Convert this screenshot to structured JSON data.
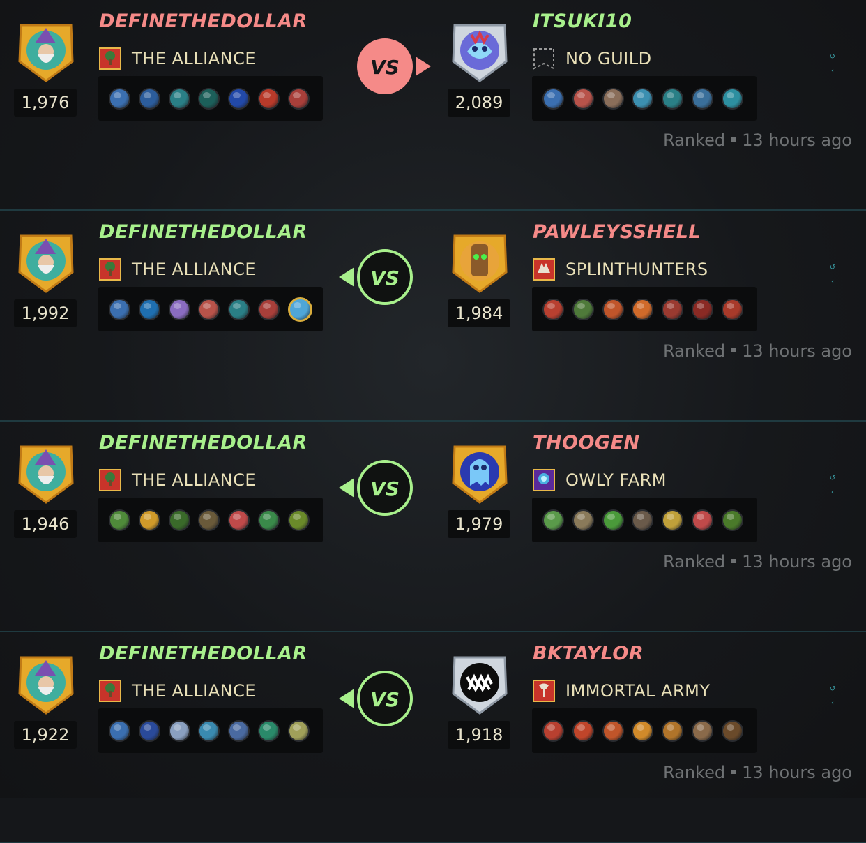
{
  "colors": {
    "winner": "#a8f08c",
    "loser": "#f58a88",
    "divider": "#1f3a40"
  },
  "battles": [
    {
      "vs_outcome": "right_won",
      "left": {
        "name": "DEFINETHEDOLLAR",
        "guild": "THE ALLIANCE",
        "guild_icon": "tree-banner-icon",
        "rating": "1,976",
        "avatar": "wizard-avatar",
        "result": "loser",
        "cards": [
          "#3b6fb0",
          "#2c5d9c",
          "#2a7f86",
          "#1c5f5a",
          "#2249a8",
          "#b83a2a",
          "#a83f3a"
        ]
      },
      "right": {
        "name": "ITSUKI10",
        "guild": "NO GUILD",
        "guild_icon": "no-guild-icon",
        "rating": "2,089",
        "avatar": "blue-monster-avatar",
        "result": "winner",
        "cards": [
          "#3b6fb0",
          "#b8534a",
          "#8a6e5a",
          "#3c8fb0",
          "#2a7f86",
          "#3a6f9a",
          "#2d8fa0"
        ]
      },
      "meta": {
        "type": "Ranked",
        "time": "13 hours ago"
      }
    },
    {
      "vs_outcome": "left_won",
      "left": {
        "name": "DEFINETHEDOLLAR",
        "guild": "THE ALLIANCE",
        "guild_icon": "tree-banner-icon",
        "rating": "1,992",
        "avatar": "wizard-avatar",
        "result": "winner",
        "cards": [
          "#3b6fb0",
          "#1f6fb0",
          "#8a6cc0",
          "#b8534a",
          "#2a7f86",
          "#a83f3a",
          "#4fa6d8"
        ]
      },
      "right": {
        "name": "PAWLEYSSHELL",
        "guild": "SPLINTHUNTERS",
        "guild_icon": "wolf-banner-icon",
        "rating": "1,984",
        "avatar": "tree-creature-avatar",
        "result": "loser",
        "cards": [
          "#b84030",
          "#4f7a3a",
          "#c0552a",
          "#d06a2a",
          "#9a3a30",
          "#8a2a24",
          "#a83a2a"
        ]
      },
      "meta": {
        "type": "Ranked",
        "time": "13 hours ago"
      }
    },
    {
      "vs_outcome": "left_won",
      "left": {
        "name": "DEFINETHEDOLLAR",
        "guild": "THE ALLIANCE",
        "guild_icon": "tree-banner-icon",
        "rating": "1,946",
        "avatar": "wizard-avatar",
        "result": "winner",
        "cards": [
          "#4f8a3a",
          "#d09a2a",
          "#3a6a2a",
          "#6a5a3a",
          "#c04a4a",
          "#3a8a4a",
          "#6a8a2a"
        ]
      },
      "right": {
        "name": "THOOGEN",
        "guild": "OWLY FARM",
        "guild_icon": "orb-banner-icon",
        "rating": "1,979",
        "avatar": "ghost-avatar",
        "result": "loser",
        "cards": [
          "#5a9a4a",
          "#8a7a5a",
          "#4a9a3a",
          "#6a5a4a",
          "#c0a03a",
          "#c04a4a",
          "#4a7a2a"
        ]
      },
      "meta": {
        "type": "Ranked",
        "time": "13 hours ago"
      }
    },
    {
      "vs_outcome": "left_won",
      "left": {
        "name": "DEFINETHEDOLLAR",
        "guild": "THE ALLIANCE",
        "guild_icon": "tree-banner-icon",
        "rating": "1,922",
        "avatar": "wizard-avatar",
        "result": "winner",
        "cards": [
          "#3b6fb0",
          "#2a4a9a",
          "#8aa0c0",
          "#3a8ab0",
          "#4a6aa0",
          "#2a8a6a",
          "#a0a05a"
        ]
      },
      "right": {
        "name": "BKTAYLOR",
        "guild": "IMMORTAL ARMY",
        "guild_icon": "axe-banner-icon",
        "rating": "1,918",
        "avatar": "fanged-mouth-avatar",
        "result": "loser",
        "cards": [
          "#b84030",
          "#c0452a",
          "#c0552a",
          "#d08a2a",
          "#b0742a",
          "#8a6a4a",
          "#6a4a2a"
        ]
      },
      "meta": {
        "type": "Ranked",
        "time": "13 hours ago"
      }
    }
  ]
}
